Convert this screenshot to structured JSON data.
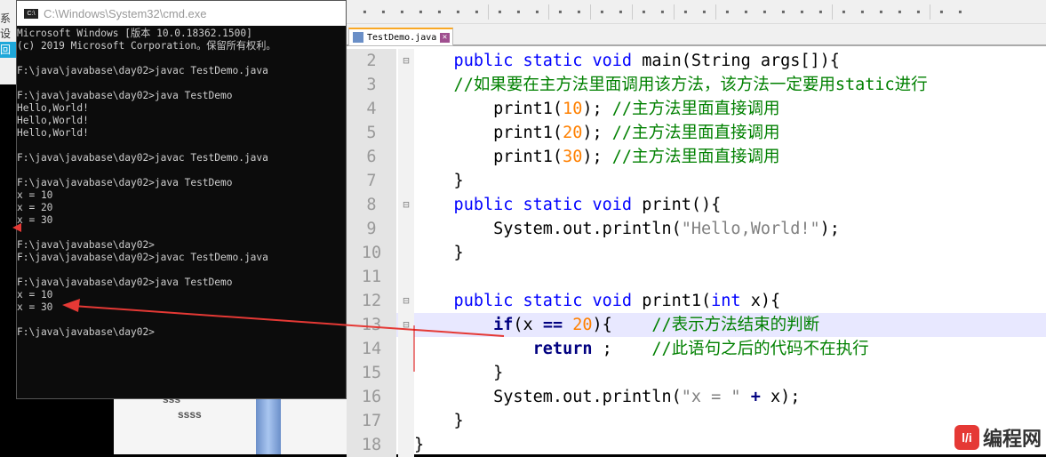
{
  "background": {
    "items": [
      "sss",
      "ssss"
    ],
    "left_labels": [
      "系设",
      "回"
    ]
  },
  "cmd": {
    "title": "C:\\Windows\\System32\\cmd.exe",
    "lines": [
      "Microsoft Windows [版本 10.0.18362.1500]",
      "(c) 2019 Microsoft Corporation。保留所有权利。",
      "",
      "F:\\java\\javabase\\day02>javac TestDemo.java",
      "",
      "F:\\java\\javabase\\day02>java TestDemo",
      "Hello,World!",
      "Hello,World!",
      "Hello,World!",
      "",
      "F:\\java\\javabase\\day02>javac TestDemo.java",
      "",
      "F:\\java\\javabase\\day02>java TestDemo",
      "x = 10",
      "x = 20",
      "x = 30",
      "",
      "F:\\java\\javabase\\day02>",
      "F:\\java\\javabase\\day02>javac TestDemo.java",
      "",
      "F:\\java\\javabase\\day02>java TestDemo",
      "x = 10",
      "x = 30",
      "",
      "F:\\java\\javabase\\day02>"
    ]
  },
  "editor": {
    "tab": "TestDemo.java",
    "highlight_line": 13,
    "lines": [
      {
        "n": "2",
        "fold": "⊟",
        "parts": [
          [
            "kw",
            "    public static void "
          ],
          [
            "",
            "main(String args[]){"
          ]
        ]
      },
      {
        "n": "3",
        "fold": "",
        "parts": [
          [
            "cm",
            "    //如果要在主方法里面调用该方法，该方法一定要用static进行"
          ]
        ]
      },
      {
        "n": "4",
        "fold": "",
        "parts": [
          [
            "",
            "        print1("
          ],
          [
            "nm",
            "10"
          ],
          [
            "",
            "); "
          ],
          [
            "cm",
            "//主方法里面直接调用"
          ]
        ]
      },
      {
        "n": "5",
        "fold": "",
        "parts": [
          [
            "",
            "        print1("
          ],
          [
            "nm",
            "20"
          ],
          [
            "",
            "); "
          ],
          [
            "cm",
            "//主方法里面直接调用"
          ]
        ]
      },
      {
        "n": "6",
        "fold": "",
        "parts": [
          [
            "",
            "        print1("
          ],
          [
            "nm",
            "30"
          ],
          [
            "",
            "); "
          ],
          [
            "cm",
            "//主方法里面直接调用"
          ]
        ]
      },
      {
        "n": "7",
        "fold": "",
        "parts": [
          [
            "",
            "    }"
          ]
        ]
      },
      {
        "n": "8",
        "fold": "⊟",
        "parts": [
          [
            "kw",
            "    public static void "
          ],
          [
            "",
            "print(){"
          ]
        ]
      },
      {
        "n": "9",
        "fold": "",
        "parts": [
          [
            "",
            "        System.out.println("
          ],
          [
            "st",
            "\"Hello,World!\""
          ],
          [
            "",
            ");"
          ]
        ]
      },
      {
        "n": "10",
        "fold": "",
        "parts": [
          [
            "",
            "    }"
          ]
        ]
      },
      {
        "n": "11",
        "fold": "",
        "parts": [
          [
            "",
            ""
          ]
        ]
      },
      {
        "n": "12",
        "fold": "⊟",
        "parts": [
          [
            "kw",
            "    public static void "
          ],
          [
            "",
            "print1("
          ],
          [
            "kw",
            "int"
          ],
          [
            "",
            " x){"
          ]
        ]
      },
      {
        "n": "13",
        "fold": "⊟",
        "parts": [
          [
            "kb",
            "        if"
          ],
          [
            "",
            "(x "
          ],
          [
            "op",
            "=="
          ],
          [
            "",
            " "
          ],
          [
            "nm",
            "20"
          ],
          [
            "",
            "){    "
          ],
          [
            "cm",
            "//表示方法结束的判断"
          ]
        ]
      },
      {
        "n": "14",
        "fold": "",
        "parts": [
          [
            "kb",
            "            return"
          ],
          [
            "",
            " ;    "
          ],
          [
            "cm",
            "//此语句之后的代码不在执行"
          ]
        ]
      },
      {
        "n": "15",
        "fold": "",
        "parts": [
          [
            "",
            "        }"
          ]
        ]
      },
      {
        "n": "16",
        "fold": "",
        "parts": [
          [
            "",
            "        System.out.println("
          ],
          [
            "st",
            "\"x = \""
          ],
          [
            "",
            " "
          ],
          [
            "op",
            "+"
          ],
          [
            "",
            " x);"
          ]
        ]
      },
      {
        "n": "17",
        "fold": "",
        "parts": [
          [
            "",
            "    }"
          ]
        ]
      },
      {
        "n": "18",
        "fold": "",
        "parts": [
          [
            "",
            "}"
          ]
        ]
      }
    ]
  },
  "watermark": {
    "mark": "编程网"
  },
  "colors": {
    "arrow": "#e53935",
    "keyword": "#0000ff",
    "comment": "#008000",
    "number": "#ff8000",
    "string": "#808080"
  }
}
